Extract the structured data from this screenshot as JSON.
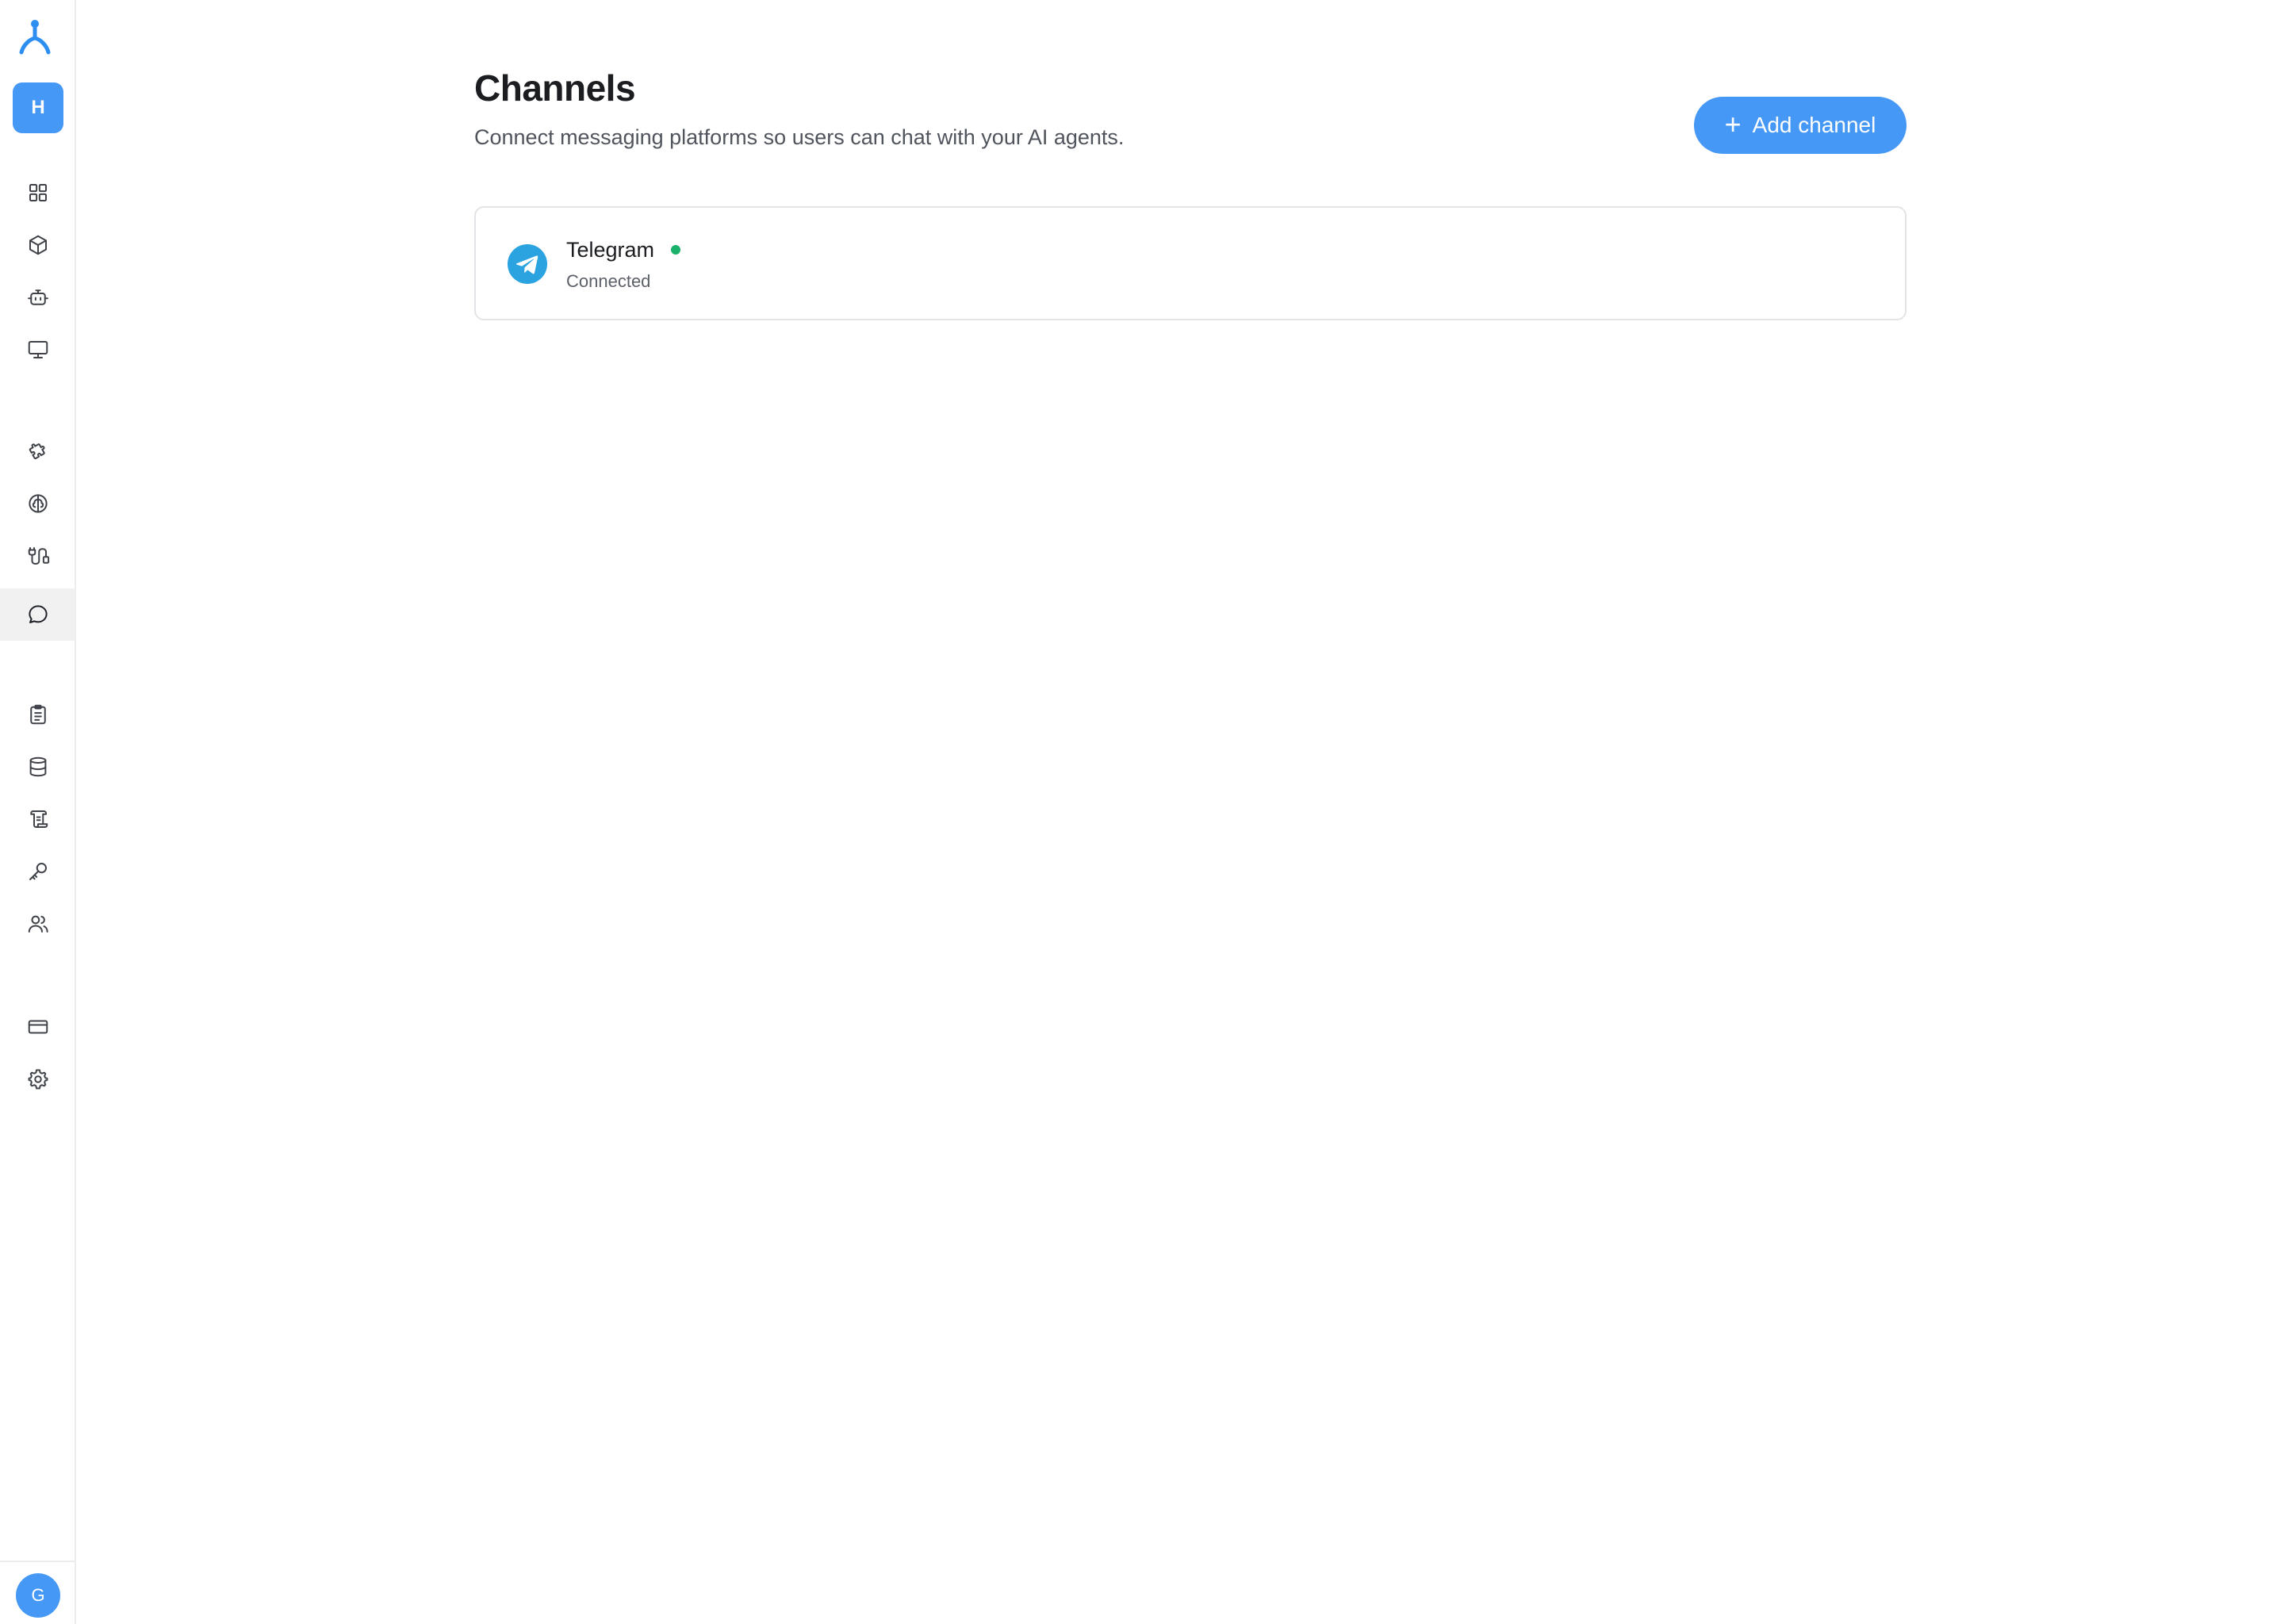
{
  "sidebar": {
    "logo_icon": "branch-logo-icon",
    "workspace_initial": "H",
    "items": [
      {
        "name": "dashboard",
        "icon": "grid-icon",
        "active": false
      },
      {
        "name": "packages",
        "icon": "cube-icon",
        "active": false
      },
      {
        "name": "agents",
        "icon": "robot-icon",
        "active": false
      },
      {
        "name": "desktops",
        "icon": "monitor-icon",
        "active": false
      },
      {
        "name": "integrations",
        "icon": "puzzle-icon",
        "active": false
      },
      {
        "name": "knowledge",
        "icon": "brain-icon",
        "active": false
      },
      {
        "name": "workflows",
        "icon": "route-icon",
        "active": false
      },
      {
        "name": "channels",
        "icon": "chat-icon",
        "active": true
      },
      {
        "name": "tasks",
        "icon": "clipboard-icon",
        "active": false
      },
      {
        "name": "data",
        "icon": "database-icon",
        "active": false
      },
      {
        "name": "logs",
        "icon": "scroll-icon",
        "active": false
      },
      {
        "name": "api-keys",
        "icon": "key-icon",
        "active": false
      },
      {
        "name": "team",
        "icon": "users-icon",
        "active": false
      },
      {
        "name": "billing",
        "icon": "credit-card-icon",
        "active": false
      },
      {
        "name": "settings",
        "icon": "gear-icon",
        "active": false
      }
    ],
    "user_initial": "G"
  },
  "header": {
    "title": "Channels",
    "subtitle": "Connect messaging platforms so users can chat with your AI agents.",
    "add_button_label": "Add channel"
  },
  "channels": [
    {
      "name": "Telegram",
      "status": "Connected",
      "icon": "telegram-icon",
      "status_color": "#1ab26a"
    }
  ],
  "colors": {
    "accent": "#4598f5",
    "telegram": "#2aa3e0",
    "connected": "#1ab26a"
  }
}
